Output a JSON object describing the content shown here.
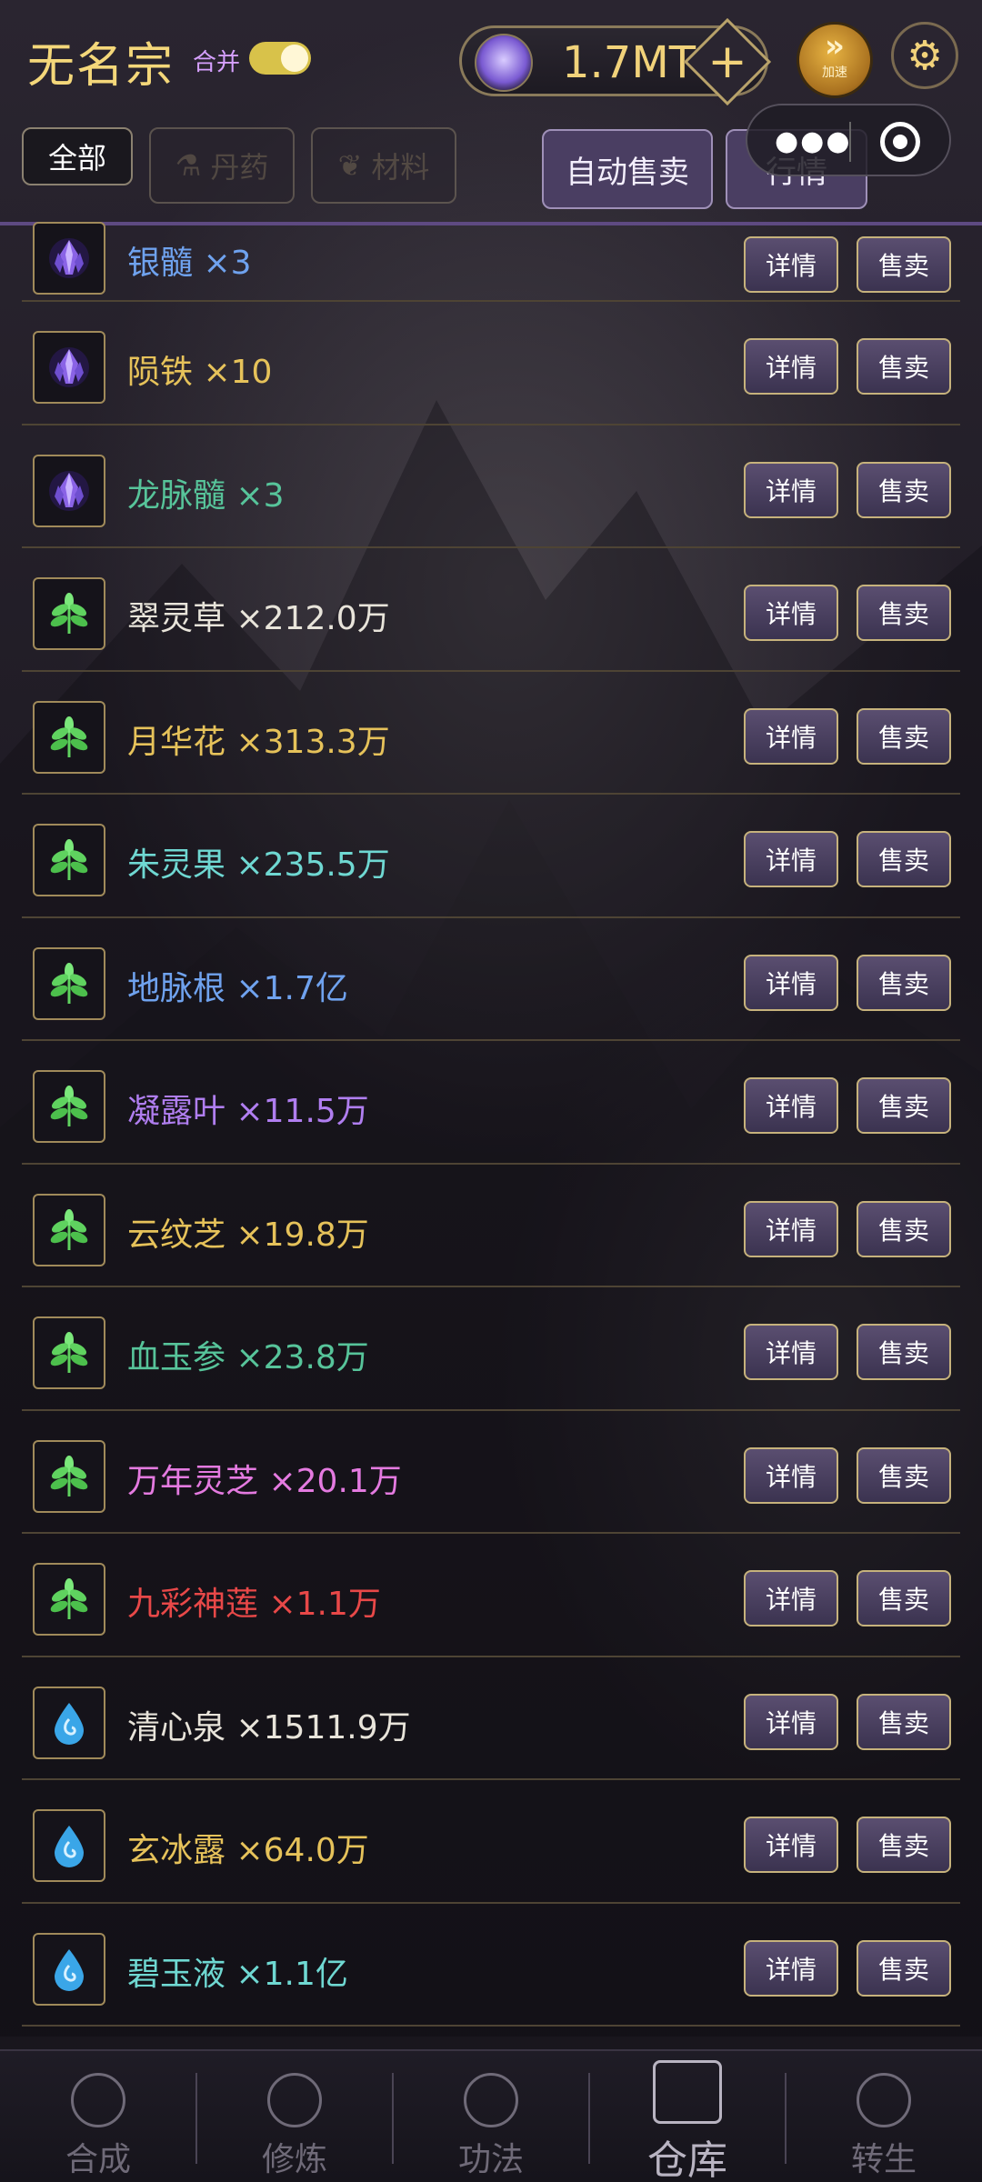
{
  "header": {
    "sect_name": "无名宗",
    "merge_label": "合并",
    "merge_on": true,
    "currency_value": "1.7MT",
    "plus_symbol": "+",
    "speed_label": "加速",
    "accent_color": "#f1d27a"
  },
  "tabs": [
    {
      "label": "全部",
      "active": true
    },
    {
      "label": "丹药",
      "active": false,
      "icon": "flask-icon"
    },
    {
      "label": "材料",
      "active": false,
      "icon": "leaf-icon"
    }
  ],
  "actions": {
    "auto_sell": "自动售卖",
    "market": "行情"
  },
  "items": [
    {
      "name": "银髓",
      "qty": "×3",
      "icon": "crystal-icon",
      "color": "#6fa2ee"
    },
    {
      "name": "陨铁",
      "qty": "×10",
      "icon": "crystal-icon",
      "color": "#e6c25a"
    },
    {
      "name": "龙脉髓",
      "qty": "×3",
      "icon": "crystal-icon",
      "color": "#57c49a"
    },
    {
      "name": "翠灵草",
      "qty": "×212.0万",
      "icon": "herb-icon",
      "color": "#e8e4da"
    },
    {
      "name": "月华花",
      "qty": "×313.3万",
      "icon": "herb-icon",
      "color": "#e6c25a"
    },
    {
      "name": "朱灵果",
      "qty": "×235.5万",
      "icon": "herb-icon",
      "color": "#6fd8d2"
    },
    {
      "name": "地脉根",
      "qty": "×1.7亿",
      "icon": "herb-icon",
      "color": "#6fa2ee"
    },
    {
      "name": "凝露叶",
      "qty": "×11.5万",
      "icon": "herb-icon",
      "color": "#b07ef0"
    },
    {
      "name": "云纹芝",
      "qty": "×19.8万",
      "icon": "herb-icon",
      "color": "#e6c25a"
    },
    {
      "name": "血玉参",
      "qty": "×23.8万",
      "icon": "herb-icon",
      "color": "#57c49a"
    },
    {
      "name": "万年灵芝",
      "qty": "×20.1万",
      "icon": "herb-icon",
      "color": "#e47ae0"
    },
    {
      "name": "九彩神莲",
      "qty": "×1.1万",
      "icon": "herb-icon",
      "color": "#e84848"
    },
    {
      "name": "清心泉",
      "qty": "×1511.9万",
      "icon": "water-drop-icon",
      "color": "#e8e4da"
    },
    {
      "name": "玄冰露",
      "qty": "×64.0万",
      "icon": "water-drop-icon",
      "color": "#e6c25a"
    },
    {
      "name": "碧玉液",
      "qty": "×1.1亿",
      "icon": "water-drop-icon",
      "color": "#6fd8d2"
    }
  ],
  "item_buttons": {
    "detail": "详情",
    "sell": "售卖"
  },
  "bottom_nav": [
    {
      "label": "合成",
      "active": false
    },
    {
      "label": "修炼",
      "active": false
    },
    {
      "label": "功法",
      "active": false
    },
    {
      "label": "仓库",
      "active": true
    },
    {
      "label": "转生",
      "active": false
    }
  ]
}
